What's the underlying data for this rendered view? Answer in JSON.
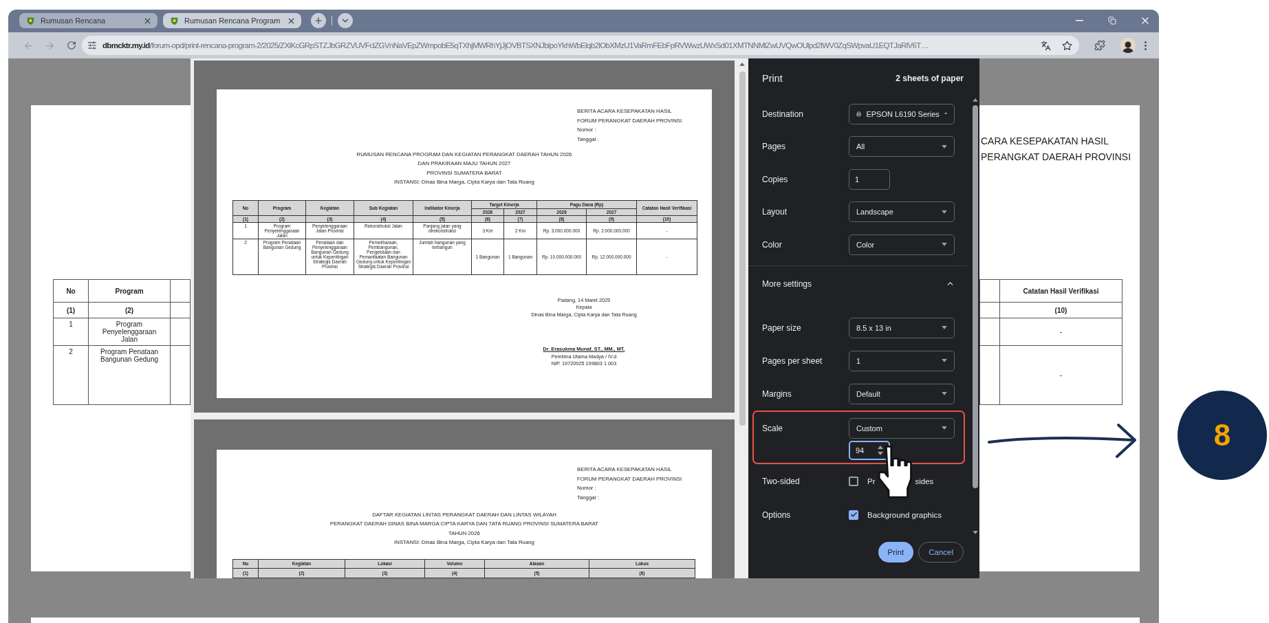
{
  "browser": {
    "tabs": [
      {
        "title": "Rumusan Rencana",
        "selected": false
      },
      {
        "title": "Rumusan Rencana Program",
        "selected": true
      }
    ],
    "address": {
      "domain": "dbmcktr.my.id",
      "path": "/forum-opd/print-rencana-program-2/2025/ZXlKcGRpSTZJbGRZVUVFclZGVnNaVEpZWmpobE5qTXhjMWRhYjJjOVBTSXNJblpoYkhWbElqb2lObXMzU1VaRmFEbFpRVWwzUWxSd01XMTNNMlZwUVQwOUlpd2lWV0ZqSWpvaU1EQTJaRlV6T…"
    }
  },
  "background_page": {
    "left_table": {
      "columns": [
        "No",
        "Program"
      ],
      "index_row": [
        "(1)",
        "(2)"
      ],
      "rows": [
        [
          "1",
          "Program Penyelenggaraan Jalan"
        ],
        [
          "2",
          "Program Penataan Bangunan Gedung"
        ]
      ]
    },
    "right_heading": [
      "CARA KESEPAKATAN HASIL",
      "PERANGKAT DAERAH PROVINSI"
    ],
    "right_table": {
      "columns": [
        "Catatan Hasil Verifikasi"
      ],
      "index_row": [
        "(10)"
      ],
      "rows": [
        [
          "-"
        ],
        [
          "-"
        ]
      ]
    }
  },
  "preview": {
    "page_1": {
      "heading": [
        "BERITA ACARA KESEPAKATAN HASIL",
        "FORUM PERANGKAT DAERAH PROVINSI",
        "Nomor :",
        "Tanggal :"
      ],
      "title": [
        "RUMUSAN RENCANA PROGRAM DAN KEGIATAN PERANGKAT DAERAH TAHUN 2026",
        "DAN PRAKIRAAN MAJU TAHUN 2027",
        "PROVINSI SUMATERA BARAT",
        "INSTANSI: Dinas Bina Marga, Cipta Karya dan Tata Ruang"
      ],
      "table": {
        "header_rows": [
          [
            {
              "label": "No",
              "rowspan": 2
            },
            {
              "label": "Program",
              "rowspan": 2
            },
            {
              "label": "Kegiatan",
              "rowspan": 2
            },
            {
              "label": "Sub Kegiatan",
              "rowspan": 2
            },
            {
              "label": "Indikator Kinerja",
              "rowspan": 2
            },
            {
              "label": "Target Kinerja",
              "colspan": 2
            },
            {
              "label": "Pagu Dana (Rp)",
              "colspan": 2
            },
            {
              "label": "Catatan Hasil Verifikasi",
              "rowspan": 2
            }
          ],
          [
            {
              "label": "2026"
            },
            {
              "label": "2027"
            },
            {
              "label": "2026"
            },
            {
              "label": "2027"
            }
          ]
        ],
        "index_row": [
          "(1)",
          "(2)",
          "(3)",
          "(4)",
          "(5)",
          "(6)",
          "(7)",
          "(8)",
          "(9)",
          "(10)"
        ],
        "rows": [
          [
            "1",
            "Program Penyelenggaraan Jalan",
            "Penyelenggaraan Jalan Provinsi",
            "Rekonstruksi Jalan",
            "Panjang jalan yang direkonstruksi",
            "3 Km",
            "2 Km",
            "Rp. 3.000.000.000",
            "Rp. 2.000.000.000",
            "-"
          ],
          [
            "2",
            "Program Penataan Bangunan Gedung",
            "Penataan dan Penyelenggaraan Bangunan Gedung untuk Kepentingan Strategis Daerah Provinsi",
            "Pemeliharaan, Pembangunan, Pengelolaan dan Pemanfaatan Bangunan Gedung untuk Kepentingan Strategis Daerah Provinsi",
            "Jumlah bangunan yang terbangun",
            "1 Bangunan",
            "1 Bangunan",
            "Rp. 10.000.000.000",
            "Rp. 12.000.000.000",
            "-"
          ]
        ]
      },
      "signature": {
        "place_date": "Padang, 14 Maret 2025",
        "position": "Kepala",
        "office": "Dinas Bina Marga, Cipta Karya dan Tata Ruang",
        "name": "Dr. Erasukma Munaf, ST., MM., MT.",
        "rank": "Pembina Utama Madya / IV.d",
        "nip": "NIP. 19720925 199803 1 003"
      }
    },
    "page_2": {
      "heading": [
        "BERITA ACARA KESEPAKATAN HASIL",
        "FORUM PERANGKAT DAERAH PROVINSI",
        "Nomor :",
        "Tanggal :"
      ],
      "title": [
        "DAFTAR KEGIATAN LINTAS PERANGKAT DAERAH DAN LINTAS WILAYAH",
        "PERANGKAT DAERAH DINAS BINA MARGA CIPTA KARYA DAN TATA RUANG PROVINSI SUMATERA BARAT",
        "TAHUN 2026",
        "INSTANSI: Dinas Bina Marga, Cipta Karya dan Tata Ruang"
      ],
      "table": {
        "columns": [
          "No",
          "Kegiatan",
          "Lokasi",
          "Volume",
          "Alasan",
          "Lokus"
        ],
        "index_row": [
          "(1)",
          "(2)",
          "(3)",
          "(4)",
          "(5)",
          "(6)"
        ]
      }
    }
  },
  "print_dialog": {
    "title": "Print",
    "sheets": "2 sheets of paper",
    "settings": [
      {
        "kind": "destination",
        "label": "Destination",
        "value": "EPSON L6190 Series"
      },
      {
        "kind": "select",
        "label": "Pages",
        "value": "All"
      },
      {
        "kind": "number",
        "label": "Copies",
        "value": "1"
      },
      {
        "kind": "select",
        "label": "Layout",
        "value": "Landscape"
      },
      {
        "kind": "select",
        "label": "Color",
        "value": "Color"
      }
    ],
    "more_settings": {
      "label": "More settings",
      "expanded": true,
      "settings": [
        {
          "kind": "select",
          "label": "Paper size",
          "value": "8.5 x 13 in"
        },
        {
          "kind": "select",
          "label": "Pages per sheet",
          "value": "1"
        },
        {
          "kind": "select",
          "label": "Margins",
          "value": "Default"
        },
        {
          "kind": "scale",
          "label": "Scale",
          "value": "Custom",
          "custom": "94",
          "highlighted": true
        },
        {
          "kind": "checkbox",
          "label": "Two-sided",
          "label_parts": [
            "Pr",
            "sides"
          ],
          "checked": false
        },
        {
          "kind": "checkbox",
          "label": "Options",
          "label_parts": [
            "Background graphics"
          ],
          "checked": true
        }
      ]
    },
    "buttons": [
      {
        "kind": "primary",
        "label": "Print"
      },
      {
        "kind": "secondary",
        "label": "Cancel"
      }
    ]
  },
  "annotation": {
    "step": "8"
  }
}
